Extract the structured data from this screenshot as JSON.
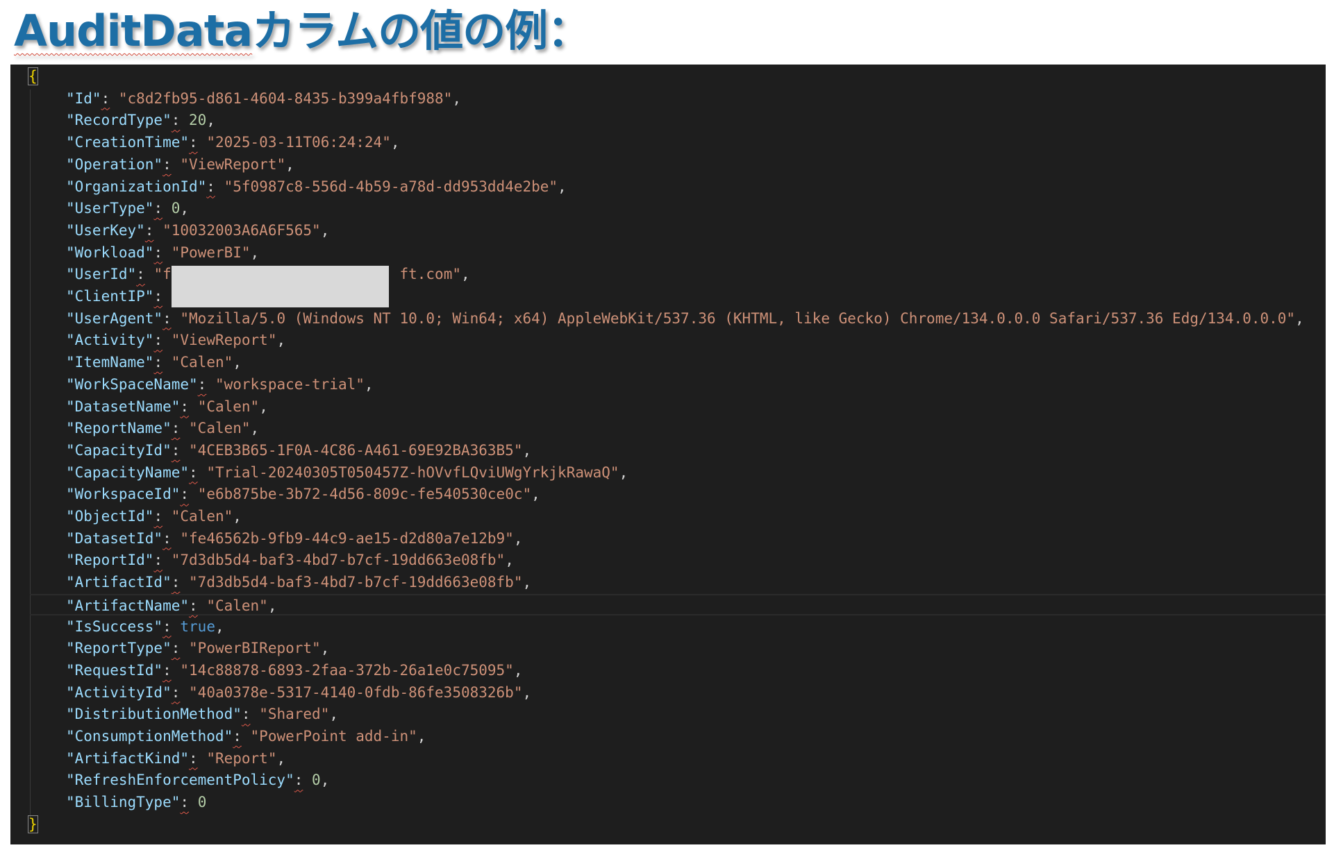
{
  "title": {
    "prefix": "AuditData",
    "suffix": "カラムの値の例："
  },
  "editor": {
    "open_brace": "{",
    "close_brace": "}",
    "lines": [
      {
        "key": "\"Id\"",
        "value": "\"c8d2fb95-d861-4604-8435-b399a4fbf988\"",
        "type": "str",
        "comma": ","
      },
      {
        "key": "\"RecordType\"",
        "value": "20",
        "type": "num",
        "comma": ","
      },
      {
        "key": "\"CreationTime\"",
        "value": "\"2025-03-11T06:24:24\"",
        "type": "str",
        "comma": ","
      },
      {
        "key": "\"Operation\"",
        "value": "\"ViewReport\"",
        "type": "str",
        "comma": ","
      },
      {
        "key": "\"OrganizationId\"",
        "value": "\"5f0987c8-556d-4b59-a78d-dd953dd4e2be\"",
        "type": "str",
        "comma": ","
      },
      {
        "key": "\"UserType\"",
        "value": "0",
        "type": "num",
        "comma": ","
      },
      {
        "key": "\"UserKey\"",
        "value": "\"10032003A6A6F565\"",
        "type": "str",
        "comma": ","
      },
      {
        "key": "\"Workload\"",
        "value": "\"PowerBI\"",
        "type": "str",
        "comma": ","
      },
      {
        "key": "\"UserId\"",
        "value": "\"f                          ft.com\"",
        "type": "str",
        "comma": ","
      },
      {
        "key": "\"ClientIP\"",
        "value": "",
        "type": "str",
        "comma": ""
      },
      {
        "key": "\"UserAgent\"",
        "value": "\"Mozilla/5.0 (Windows NT 10.0; Win64; x64) AppleWebKit/537.36 (KHTML, like Gecko) Chrome/134.0.0.0 Safari/537.36 Edg/134.0.0.0\"",
        "type": "str",
        "comma": ","
      },
      {
        "key": "\"Activity\"",
        "value": "\"ViewReport\"",
        "type": "str",
        "comma": ","
      },
      {
        "key": "\"ItemName\"",
        "value": "\"Calen\"",
        "type": "str",
        "comma": ","
      },
      {
        "key": "\"WorkSpaceName\"",
        "value": "\"workspace-trial\"",
        "type": "str",
        "comma": ","
      },
      {
        "key": "\"DatasetName\"",
        "value": "\"Calen\"",
        "type": "str",
        "comma": ","
      },
      {
        "key": "\"ReportName\"",
        "value": "\"Calen\"",
        "type": "str",
        "comma": ","
      },
      {
        "key": "\"CapacityId\"",
        "value": "\"4CEB3B65-1F0A-4C86-A461-69E92BA363B5\"",
        "type": "str",
        "comma": ","
      },
      {
        "key": "\"CapacityName\"",
        "value": "\"Trial-20240305T050457Z-hOVvfLQviUWgYrkjkRawaQ\"",
        "type": "str",
        "comma": ","
      },
      {
        "key": "\"WorkspaceId\"",
        "value": "\"e6b875be-3b72-4d56-809c-fe540530ce0c\"",
        "type": "str",
        "comma": ","
      },
      {
        "key": "\"ObjectId\"",
        "value": "\"Calen\"",
        "type": "str",
        "comma": ","
      },
      {
        "key": "\"DatasetId\"",
        "value": "\"fe46562b-9fb9-44c9-ae15-d2d80a7e12b9\"",
        "type": "str",
        "comma": ","
      },
      {
        "key": "\"ReportId\"",
        "value": "\"7d3db5d4-baf3-4bd7-b7cf-19dd663e08fb\"",
        "type": "str",
        "comma": ","
      },
      {
        "key": "\"ArtifactId\"",
        "value": "\"7d3db5d4-baf3-4bd7-b7cf-19dd663e08fb\"",
        "type": "str",
        "comma": ","
      },
      {
        "key": "\"ArtifactName\"",
        "value": "\"Calen\"",
        "type": "str",
        "comma": ","
      },
      {
        "key": "\"IsSuccess\"",
        "value": "true",
        "type": "bool",
        "comma": ","
      },
      {
        "key": "\"ReportType\"",
        "value": "\"PowerBIReport\"",
        "type": "str",
        "comma": ","
      },
      {
        "key": "\"RequestId\"",
        "value": "\"14c88878-6893-2faa-372b-26a1e0c75095\"",
        "type": "str",
        "comma": ","
      },
      {
        "key": "\"ActivityId\"",
        "value": "\"40a0378e-5317-4140-0fdb-86fe3508326b\"",
        "type": "str",
        "comma": ","
      },
      {
        "key": "\"DistributionMethod\"",
        "value": "\"Shared\"",
        "type": "str",
        "comma": ","
      },
      {
        "key": "\"ConsumptionMethod\"",
        "value": "\"PowerPoint add-in\"",
        "type": "str",
        "comma": ","
      },
      {
        "key": "\"ArtifactKind\"",
        "value": "\"Report\"",
        "type": "str",
        "comma": ","
      },
      {
        "key": "\"RefreshEnforcementPolicy\"",
        "value": "0",
        "type": "num",
        "comma": ","
      },
      {
        "key": "\"BillingType\"",
        "value": "0",
        "type": "num",
        "comma": ""
      }
    ],
    "current_line": "\"ArtifactName\""
  }
}
